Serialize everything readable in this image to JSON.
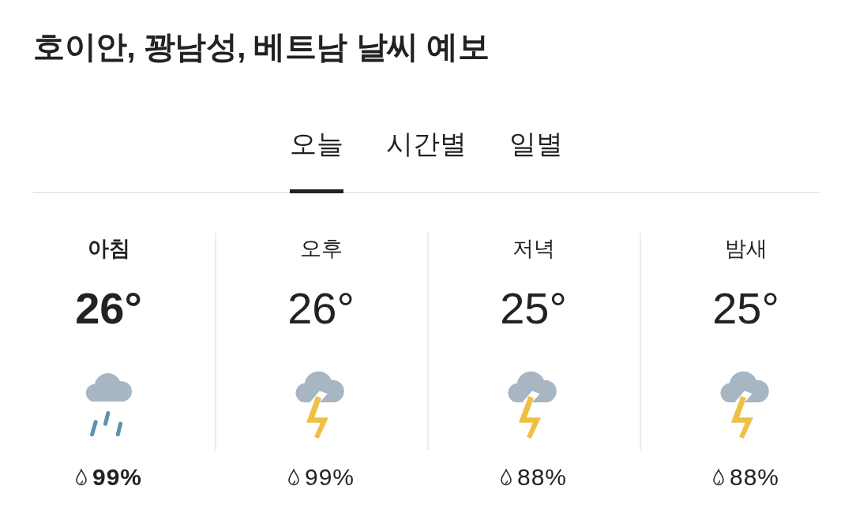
{
  "title": "호이안, 꽝남성, 베트남 날씨 예보",
  "tabs": [
    {
      "label": "오늘",
      "selected": true
    },
    {
      "label": "시간별",
      "selected": false
    },
    {
      "label": "일별",
      "selected": false
    }
  ],
  "periods": [
    {
      "name": "아침",
      "selected": true,
      "temperature": "26°",
      "kind": "rain",
      "precipitation": "99%"
    },
    {
      "name": "오후",
      "selected": false,
      "temperature": "26°",
      "kind": "thunderstorm",
      "precipitation": "99%"
    },
    {
      "name": "저녁",
      "selected": false,
      "temperature": "25°",
      "kind": "thunderstorm",
      "precipitation": "88%"
    },
    {
      "name": "밤새",
      "selected": false,
      "temperature": "25°",
      "kind": "thunderstorm",
      "precipitation": "88%"
    }
  ]
}
